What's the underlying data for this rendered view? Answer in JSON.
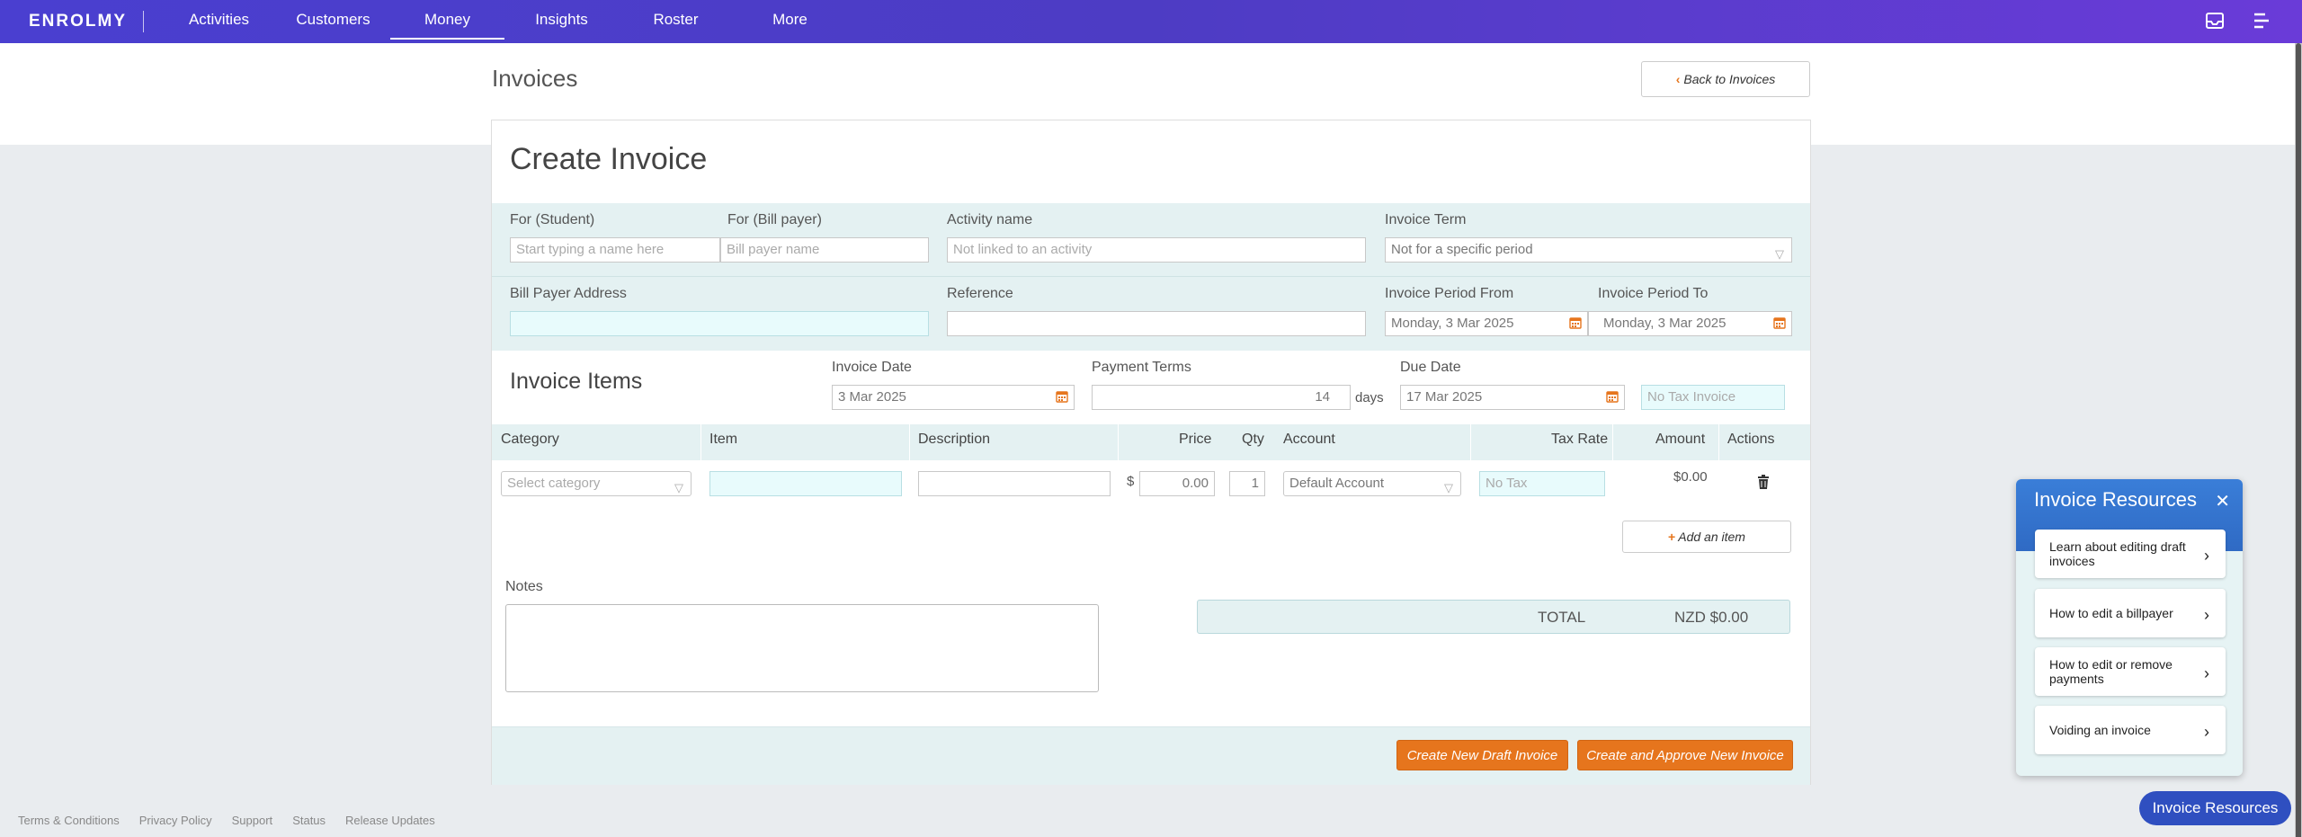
{
  "app": {
    "logo": "ENROLMY"
  },
  "nav": [
    "Activities",
    "Customers",
    "Money",
    "Insights",
    "Roster",
    "More"
  ],
  "page": {
    "title": "Invoices",
    "back_label": "Back to Invoices"
  },
  "form": {
    "title": "Create Invoice",
    "student_label": "For (Student)",
    "student_placeholder": "Start typing a name here",
    "billpayer_label": "For (Bill payer)",
    "billpayer_placeholder": "Bill payer name",
    "activity_label": "Activity name",
    "activity_placeholder": "Not linked to an activity",
    "term_label": "Invoice Term",
    "term_value": "Not for a specific period",
    "address_label": "Bill Payer Address",
    "reference_label": "Reference",
    "period_from_label": "Invoice Period From",
    "period_from_value": "Monday, 3 Mar 2025",
    "period_to_label": "Invoice Period To",
    "period_to_value": "Monday, 3 Mar 2025"
  },
  "items": {
    "title": "Invoice Items",
    "invoice_date_label": "Invoice Date",
    "invoice_date_value": "3 Mar 2025",
    "payment_terms_label": "Payment Terms",
    "payment_terms_value": "14",
    "payment_terms_unit": "days",
    "due_date_label": "Due Date",
    "due_date_value": "17 Mar 2025",
    "tax_invoice_placeholder": "No Tax Invoice",
    "columns": [
      "Category",
      "Item",
      "Description",
      "Price",
      "Qty",
      "Account",
      "Tax Rate",
      "Amount",
      "Actions"
    ],
    "row": {
      "category_placeholder": "Select category",
      "currency_symbol": "$",
      "price_value": "0.00",
      "qty_value": "1",
      "account_value": "Default Account",
      "tax_placeholder": "No Tax",
      "amount": "$0.00"
    },
    "add_item_label": "Add an item"
  },
  "notes_label": "Notes",
  "total": {
    "label": "TOTAL",
    "value": "NZD $0.00"
  },
  "actions": {
    "draft_label": "Create New Draft Invoice",
    "approve_label": "Create and Approve New Invoice"
  },
  "footer_links": [
    "Terms & Conditions",
    "Privacy Policy",
    "Support",
    "Status",
    "Release Updates"
  ],
  "resources": {
    "title": "Invoice Resources",
    "items": [
      "Learn about editing draft invoices",
      "How to edit a billpayer",
      "How to edit or remove payments",
      "Voiding an invoice"
    ],
    "fab_label": "Invoice Resources"
  },
  "colors": {
    "brand": "#4a3fd0",
    "accent": "#e6751d",
    "panel": "#e4f1f2",
    "resources": "#2f6ac4"
  }
}
